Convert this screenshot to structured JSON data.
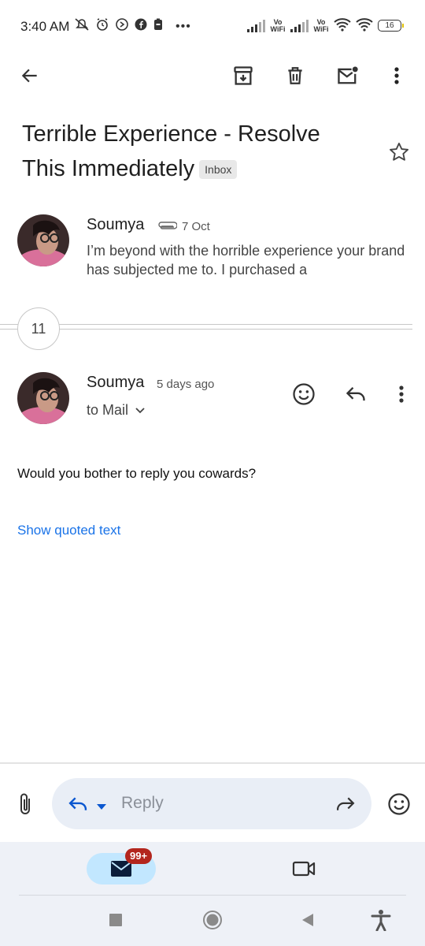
{
  "status_bar": {
    "time": "3:40 AM",
    "battery": "16",
    "vowifi_1": "Vo WiFi",
    "vowifi_2": "Vo WiFi",
    "more": "•••"
  },
  "toolbar": {
    "back_icon": "arrow-left-icon",
    "archive_icon": "archive-icon",
    "delete_icon": "trash-icon",
    "mark_unread_icon": "mail-unread-icon",
    "more_icon": "more-vert-icon"
  },
  "subject": {
    "title": "Terrible Experience - Resolve This Immediately",
    "label": "Inbox"
  },
  "messages": [
    {
      "sender": "Soumya",
      "date": "7 Oct",
      "has_attachment": true,
      "snippet": "I’m beyond with the horrible experience your brand has subjected me to. I purchased a"
    },
    {
      "sender": "Soumya",
      "date": "5 days ago",
      "recipient": "to Mail",
      "body": "Would you bother to reply you cowards?",
      "show_quoted": "Show quoted text"
    }
  ],
  "collapsed_count": "11",
  "composer": {
    "placeholder": "Reply"
  },
  "bottom_nav": {
    "mail_badge": "99+",
    "mail_icon": "mail-icon",
    "meet_icon": "video-icon"
  },
  "colors": {
    "accent": "#1a73e8",
    "badge_red": "#b3261e",
    "pill_bg": "#e9eef6",
    "nav_active": "#c2e7ff"
  }
}
